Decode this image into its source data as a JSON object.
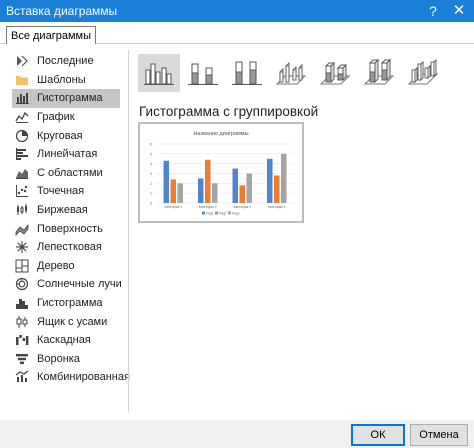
{
  "window": {
    "title": "Вставка диаграммы",
    "help": "?",
    "close": "✕"
  },
  "tab": {
    "label": "Все диаграммы"
  },
  "sidebar": {
    "items": [
      {
        "label": "Последние",
        "icon": "recent-icon"
      },
      {
        "label": "Шаблоны",
        "icon": "folder-icon"
      },
      {
        "label": "Гистограмма",
        "icon": "column-chart-icon",
        "selected": true
      },
      {
        "label": "График",
        "icon": "line-chart-icon"
      },
      {
        "label": "Круговая",
        "icon": "pie-chart-icon"
      },
      {
        "label": "Линейчатая",
        "icon": "bar-chart-icon"
      },
      {
        "label": "С областями",
        "icon": "area-chart-icon"
      },
      {
        "label": "Точечная",
        "icon": "scatter-chart-icon"
      },
      {
        "label": "Биржевая",
        "icon": "stock-chart-icon"
      },
      {
        "label": "Поверхность",
        "icon": "surface-chart-icon"
      },
      {
        "label": "Лепестковая",
        "icon": "radar-chart-icon"
      },
      {
        "label": "Дерево",
        "icon": "treemap-icon"
      },
      {
        "label": "Солнечные лучи",
        "icon": "sunburst-icon"
      },
      {
        "label": "Гистограмма",
        "icon": "histogram-icon"
      },
      {
        "label": "Ящик с усами",
        "icon": "box-whisker-icon"
      },
      {
        "label": "Каскадная",
        "icon": "waterfall-icon"
      },
      {
        "label": "Воронка",
        "icon": "funnel-icon"
      },
      {
        "label": "Комбинированная",
        "icon": "combo-chart-icon"
      }
    ]
  },
  "subtypes": {
    "selected_title": "Гистограмма с группировкой",
    "icons": [
      "clustered-column-icon",
      "stacked-column-icon",
      "stacked-100-column-icon",
      "3d-clustered-column-icon",
      "3d-stacked-column-icon",
      "3d-stacked-100-column-icon",
      "3d-column-icon"
    ]
  },
  "preview": {
    "chart_data": {
      "type": "bar",
      "title": "Название диаграммы",
      "categories": [
        "Категория 1",
        "Категория 2",
        "Категория 3",
        "Категория 4"
      ],
      "series": [
        {
          "name": "Ряд1",
          "values": [
            4.3,
            2.5,
            3.5,
            4.5
          ],
          "color": "#4f86cc"
        },
        {
          "name": "Ряд2",
          "values": [
            2.4,
            4.4,
            1.8,
            2.8
          ],
          "color": "#ed7d31"
        },
        {
          "name": "Ряд3",
          "values": [
            2.0,
            2.0,
            3.0,
            5.0
          ],
          "color": "#a5a5a5"
        }
      ],
      "ylim": [
        0,
        6
      ],
      "yticks": [
        "0",
        "1",
        "2",
        "3",
        "4",
        "5",
        "6"
      ],
      "grid": true,
      "legend": "bottom"
    }
  },
  "buttons": {
    "ok": "ОК",
    "cancel": "Отмена"
  },
  "colors": {
    "titlebar": "#1a7fd6",
    "selection": "#c5c5c5",
    "accent": "#0078d7"
  }
}
